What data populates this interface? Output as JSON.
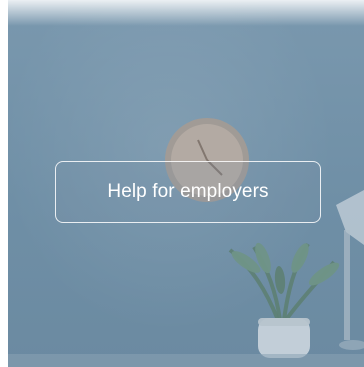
{
  "card": {
    "cta_label": "Help for employers",
    "overlay_color": "#6f8fa6",
    "text_color": "#ffffff"
  },
  "icons": {
    "clock": "wall-clock",
    "plant": "potted-plant",
    "lamp": "desk-lamp"
  }
}
